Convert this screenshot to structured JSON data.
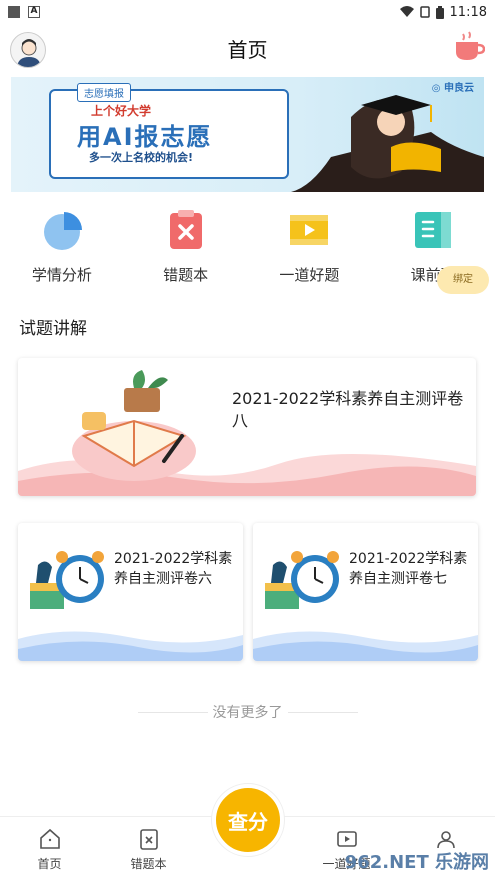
{
  "status": {
    "time": "11:18"
  },
  "header": {
    "title": "首页"
  },
  "banner": {
    "tag": "志愿填报",
    "line1": "上个好大学",
    "line2": "用AI报志愿",
    "line3": "多一次上名校的机会!",
    "brand": "◎ 申良云"
  },
  "quick": [
    {
      "label": "学情分析",
      "icon": "pie-chart-icon"
    },
    {
      "label": "错题本",
      "icon": "wrong-book-icon"
    },
    {
      "label": "一道好题",
      "icon": "video-icon"
    },
    {
      "label": "课前预",
      "icon": "book-icon"
    }
  ],
  "bind_badge": "绑定",
  "section_title": "试题讲解",
  "cards": {
    "big": {
      "title": "2021-2022学科素养自主测评卷八"
    },
    "left": {
      "title": "2021-2022学科素养自主测评卷六"
    },
    "right": {
      "title": "2021-2022学科素养自主测评卷七"
    }
  },
  "nomore": "没有更多了",
  "tabs": [
    {
      "label": "首页",
      "icon": "home-icon"
    },
    {
      "label": "错题本",
      "icon": "wrong-book-icon"
    },
    {
      "label": "",
      "icon": ""
    },
    {
      "label": "一道好题",
      "icon": "video-icon"
    },
    {
      "label": "",
      "icon": "user-icon"
    }
  ],
  "center_button": "查分",
  "watermark": "962.NET 乐游网",
  "colors": {
    "accent": "#f7b500",
    "brand_blue": "#2a6fb8"
  }
}
